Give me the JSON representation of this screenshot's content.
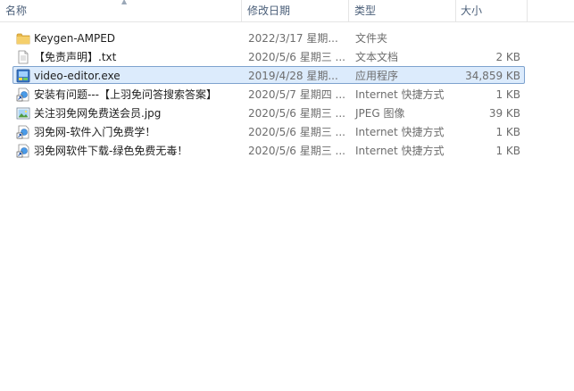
{
  "columns": {
    "name": "名称",
    "date": "修改日期",
    "type": "类型",
    "size": "大小"
  },
  "files": [
    {
      "name": "Keygen-AMPED",
      "date": "2022/3/17 星期...",
      "type": "文件夹",
      "size": "",
      "icon": "folder-icon"
    },
    {
      "name": "【免责声明】.txt",
      "date": "2020/5/6 星期三 ...",
      "type": "文本文档",
      "size": "2 KB",
      "icon": "text-file-icon"
    },
    {
      "name": "video-editor.exe",
      "date": "2019/4/28 星期...",
      "type": "应用程序",
      "size": "34,859 KB",
      "icon": "application-icon",
      "selected": true
    },
    {
      "name": "安装有问题---【上羽免问答搜索答案】",
      "date": "2020/5/7 星期四 ...",
      "type": "Internet 快捷方式",
      "size": "1 KB",
      "icon": "internet-shortcut-icon"
    },
    {
      "name": "关注羽免网免费送会员.jpg",
      "date": "2020/5/6 星期三 ...",
      "type": "JPEG 图像",
      "size": "39 KB",
      "icon": "image-file-icon"
    },
    {
      "name": "羽免网-软件入门免费学！",
      "date": "2020/5/6 星期三 ...",
      "type": "Internet 快捷方式",
      "size": "1 KB",
      "icon": "internet-shortcut-icon"
    },
    {
      "name": "羽免网软件下载-绿色免费无毒！",
      "date": "2020/5/6 星期三 ...",
      "type": "Internet 快捷方式",
      "size": "1 KB",
      "icon": "internet-shortcut-icon"
    }
  ]
}
